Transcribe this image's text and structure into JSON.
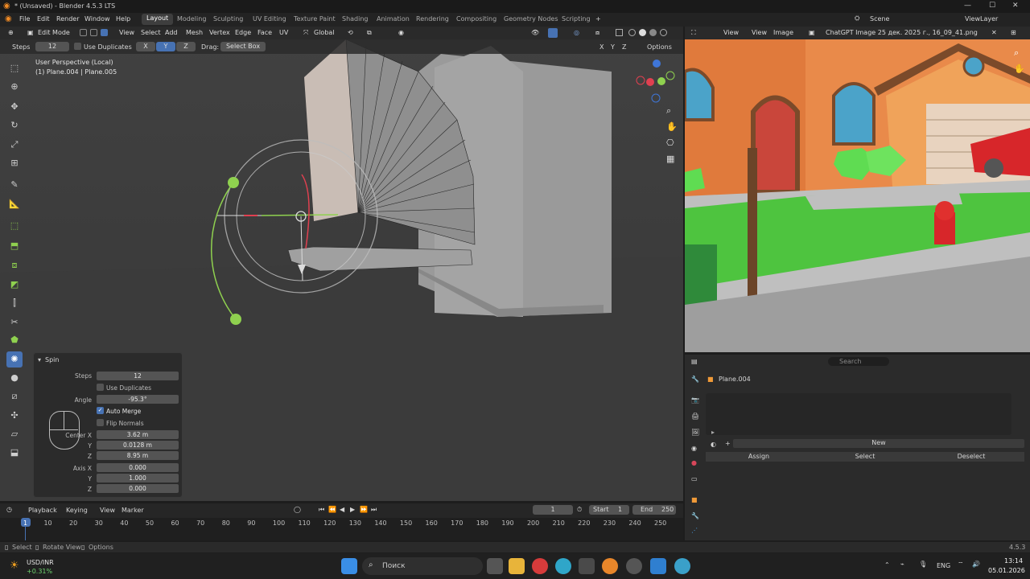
{
  "title": "* (Unsaved) - Blender 4.5.3 LTS",
  "menus": [
    "File",
    "Edit",
    "Render",
    "Window",
    "Help"
  ],
  "workspaces": [
    "Layout",
    "Modeling",
    "Sculpting",
    "UV Editing",
    "Texture Paint",
    "Shading",
    "Animation",
    "Rendering",
    "Compositing",
    "Geometry Nodes",
    "Scripting"
  ],
  "scene": "Scene",
  "view_layer": "ViewLayer",
  "vp": {
    "mode": "Edit Mode",
    "view": "View",
    "select": "Select",
    "add": "Add",
    "mesh": "Mesh",
    "vertex": "Vertex",
    "edge": "Edge",
    "face": "Face",
    "uv": "UV",
    "orient": "Global",
    "options": "Options",
    "x": "X",
    "y": "Y",
    "z": "Z"
  },
  "toolhdr": {
    "steps_label": "Steps",
    "steps": "12",
    "dup": "Use Duplicates",
    "x": "X",
    "y": "Y",
    "z": "Z",
    "drag": "Drag:",
    "drag_val": "Select Box"
  },
  "overlay": {
    "persp": "User Perspective (Local)",
    "obj": "(1) Plane.004 | Plane.005"
  },
  "spin": {
    "title": "Spin",
    "steps_l": "Steps",
    "steps": "12",
    "dup": "Use Duplicates",
    "angle_l": "Angle",
    "angle": "-95.3°",
    "merge": "Auto Merge",
    "flip": "Flip Normals",
    "center_l": "Center X",
    "cx": "3.62 m",
    "y_l": "Y",
    "cy": "0.0128 m",
    "z_l": "Z",
    "cz": "8.95 m",
    "axis_l": "Axis X",
    "ax": "0.000",
    "ay": "1.000",
    "az": "0.000"
  },
  "imged": {
    "view": "View",
    "view2": "View",
    "image": "Image",
    "file": "ChatGPT Image 25 дек. 2025 г., 16_09_41.png"
  },
  "props": {
    "search": "Search",
    "obj": "Plane.004",
    "new": "New",
    "assign": "Assign",
    "select": "Select",
    "deselect": "Deselect"
  },
  "timeline": {
    "playback": "Playback",
    "keying": "Keying",
    "view": "View",
    "marker": "Marker",
    "frame": "1",
    "start_l": "Start",
    "start": "1",
    "end_l": "End",
    "end": "250",
    "ticks": [
      "1",
      "10",
      "20",
      "30",
      "40",
      "50",
      "60",
      "70",
      "80",
      "90",
      "100",
      "110",
      "120",
      "130",
      "140",
      "150",
      "160",
      "170",
      "180",
      "190",
      "200",
      "210",
      "220",
      "230",
      "240",
      "250"
    ]
  },
  "status": {
    "select": "Select",
    "rotate": "Rotate View",
    "options": "Options",
    "version": "4.5.3"
  },
  "taskbar": {
    "ticker": "USD/INR",
    "change": "+0.31%",
    "search": "Поиск",
    "lang": "ENG",
    "time": "13:14",
    "date": "05.01.2026"
  },
  "colors": {
    "accent": "#4772b3",
    "gizmo_green": "#8fd14f",
    "wall": "#e98a4a",
    "grass": "#4ec43f"
  }
}
